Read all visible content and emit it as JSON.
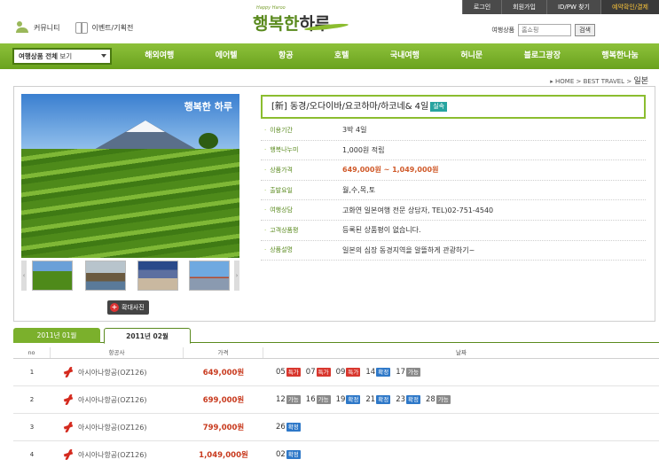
{
  "util": [
    "로그인",
    "회원가입",
    "ID/PW 찾기",
    "예약확인/결제"
  ],
  "top_links": {
    "community": "커뮤니티",
    "events": "이벤트/기획전"
  },
  "logo": {
    "small": "Happy Haroo",
    "text_a": "행복한",
    "text_b": "하루"
  },
  "search": {
    "label": "여행상품",
    "placeholder": "홈쇼핑",
    "button": "검색"
  },
  "nav": {
    "select_label_bold": "여행상품 전체",
    "select_label": "보기",
    "menu": [
      "해외여행",
      "에어텔",
      "항공",
      "호텔",
      "국내여행",
      "허니문",
      "블로그광장",
      "행복한나눔"
    ]
  },
  "breadcrumb": {
    "home": "▸ HOME",
    "sep": ">",
    "best": "BEST TRAVEL",
    "current": "일본"
  },
  "product": {
    "watermark": "행복한 하루",
    "title": "[新] 동경/오다이바/요코하마/하코네&  4일",
    "badge": "실속",
    "zoom_label": "확대사진",
    "info": [
      {
        "k": "이용기간",
        "v": "3박 4일"
      },
      {
        "k": "행복나누미",
        "v": "1,000원 적립"
      },
      {
        "k": "상품가격",
        "v": "649,000원 ~ 1,049,000원",
        "price": true
      },
      {
        "k": "출발요일",
        "v": "월,수,목,토"
      },
      {
        "k": "여행상담",
        "v": "고화연   일본여행 전문 상담자, TEL)02-751-4540"
      },
      {
        "k": "고객상품평",
        "v": "등록된 상품평이 없습니다."
      },
      {
        "k": "상품설명",
        "v": "일본의 심장 동경지역을 알뜰하게 관광하기~"
      }
    ]
  },
  "tabs": [
    "2011년 01월",
    "2011년 02월"
  ],
  "table": {
    "headers": [
      "no",
      "항공사",
      "가격",
      "날짜"
    ],
    "rows": [
      {
        "no": "1",
        "airline": "아시아나항공(OZ126)",
        "price": "649,000원",
        "dates": [
          {
            "d": "05",
            "t": "특가",
            "c": "special"
          },
          {
            "d": "07",
            "t": "특가",
            "c": "special"
          },
          {
            "d": "09",
            "t": "특가",
            "c": "special"
          },
          {
            "d": "14",
            "t": "확정",
            "c": "confirm"
          },
          {
            "d": "17",
            "t": "가능",
            "c": "avail"
          }
        ]
      },
      {
        "no": "2",
        "airline": "아시아나항공(OZ126)",
        "price": "699,000원",
        "dates": [
          {
            "d": "12",
            "t": "가능",
            "c": "avail"
          },
          {
            "d": "16",
            "t": "가능",
            "c": "avail"
          },
          {
            "d": "19",
            "t": "확정",
            "c": "confirm"
          },
          {
            "d": "21",
            "t": "확정",
            "c": "confirm"
          },
          {
            "d": "23",
            "t": "확정",
            "c": "confirm"
          },
          {
            "d": "28",
            "t": "가능",
            "c": "avail"
          }
        ]
      },
      {
        "no": "3",
        "airline": "아시아나항공(OZ126)",
        "price": "799,000원",
        "dates": [
          {
            "d": "26",
            "t": "확정",
            "c": "confirm"
          }
        ]
      },
      {
        "no": "4",
        "airline": "아시아나항공(OZ126)",
        "price": "1,049,000원",
        "dates": [
          {
            "d": "02",
            "t": "확정",
            "c": "confirm"
          }
        ]
      }
    ]
  }
}
